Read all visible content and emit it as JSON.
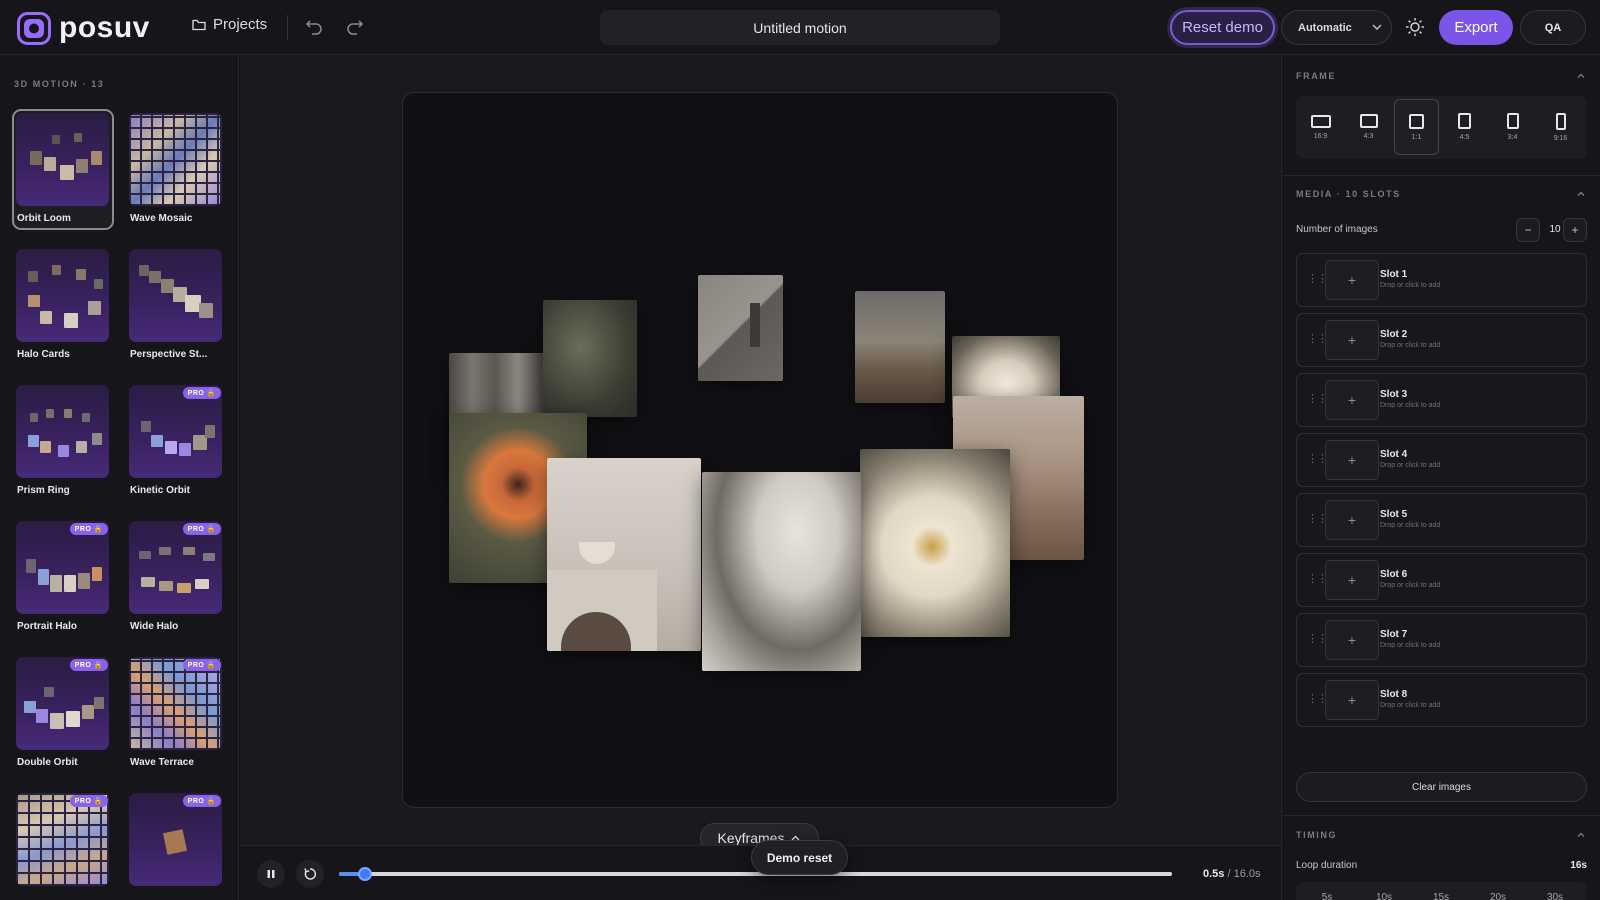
{
  "app": {
    "name": "posuv",
    "document_title": "Untitled motion"
  },
  "toolbar": {
    "projects_label": "Projects",
    "reset_label": "Reset demo",
    "quality_value": "Automatic",
    "export_label": "Export",
    "qa_label": "QA",
    "icons": [
      "folder-icon",
      "undo-icon",
      "redo-icon",
      "chevron-down-icon",
      "sun-icon"
    ]
  },
  "sidebar": {
    "section_label": "3D MOTION · 13",
    "presets": [
      {
        "label": "Orbit Loom",
        "pro": false,
        "active": true
      },
      {
        "label": "Wave Mosaic",
        "pro": false,
        "active": false
      },
      {
        "label": "Halo Cards",
        "pro": false,
        "active": false
      },
      {
        "label": "Perspective St...",
        "pro": false,
        "active": false
      },
      {
        "label": "Prism Ring",
        "pro": false,
        "active": false
      },
      {
        "label": "Kinetic Orbit",
        "pro": true,
        "active": false
      },
      {
        "label": "Portrait Halo",
        "pro": true,
        "active": false
      },
      {
        "label": "Wide Halo",
        "pro": true,
        "active": false
      },
      {
        "label": "Double Orbit",
        "pro": true,
        "active": false
      },
      {
        "label": "Wave Terrace",
        "pro": true,
        "active": false
      },
      {
        "label": "",
        "pro": true,
        "active": false
      },
      {
        "label": "",
        "pro": true,
        "active": false
      }
    ],
    "pro_badge": "PRO 🔒"
  },
  "canvas": {
    "keyframes_label": "Keyframes",
    "toast": "Demo reset"
  },
  "transport": {
    "current_time": "0.5s",
    "total_time": "16.0s",
    "separator": " / ",
    "progress": 0.031
  },
  "panel": {
    "frame": {
      "title": "FRAME",
      "ratios": [
        "16:9",
        "4:3",
        "1:1",
        "4:5",
        "3:4",
        "9:16"
      ],
      "selected": "1:1"
    },
    "media": {
      "title": "MEDIA · 10 SLOTS",
      "count_label": "Number of images",
      "count": "10",
      "decrement": "−",
      "increment": "+",
      "slots": [
        {
          "name": "Slot 1",
          "hint": "Drop or click to add"
        },
        {
          "name": "Slot 2",
          "hint": "Drop or click to add"
        },
        {
          "name": "Slot 3",
          "hint": "Drop or click to add"
        },
        {
          "name": "Slot 4",
          "hint": "Drop or click to add"
        },
        {
          "name": "Slot 5",
          "hint": "Drop or click to add"
        },
        {
          "name": "Slot 6",
          "hint": "Drop or click to add"
        },
        {
          "name": "Slot 7",
          "hint": "Drop or click to add"
        },
        {
          "name": "Slot 8",
          "hint": "Drop or click to add"
        }
      ],
      "add_glyph": "+",
      "clear_label": "Clear images"
    },
    "timing": {
      "title": "TIMING",
      "loop_label": "Loop duration",
      "loop_value": "16s",
      "options": [
        "5s",
        "10s",
        "15s",
        "20s",
        "30s"
      ],
      "slider_seconds": 16
    }
  },
  "colors": {
    "accent": "#7a55e8",
    "scrubber": "#3d7bf0",
    "background": "#131316"
  }
}
